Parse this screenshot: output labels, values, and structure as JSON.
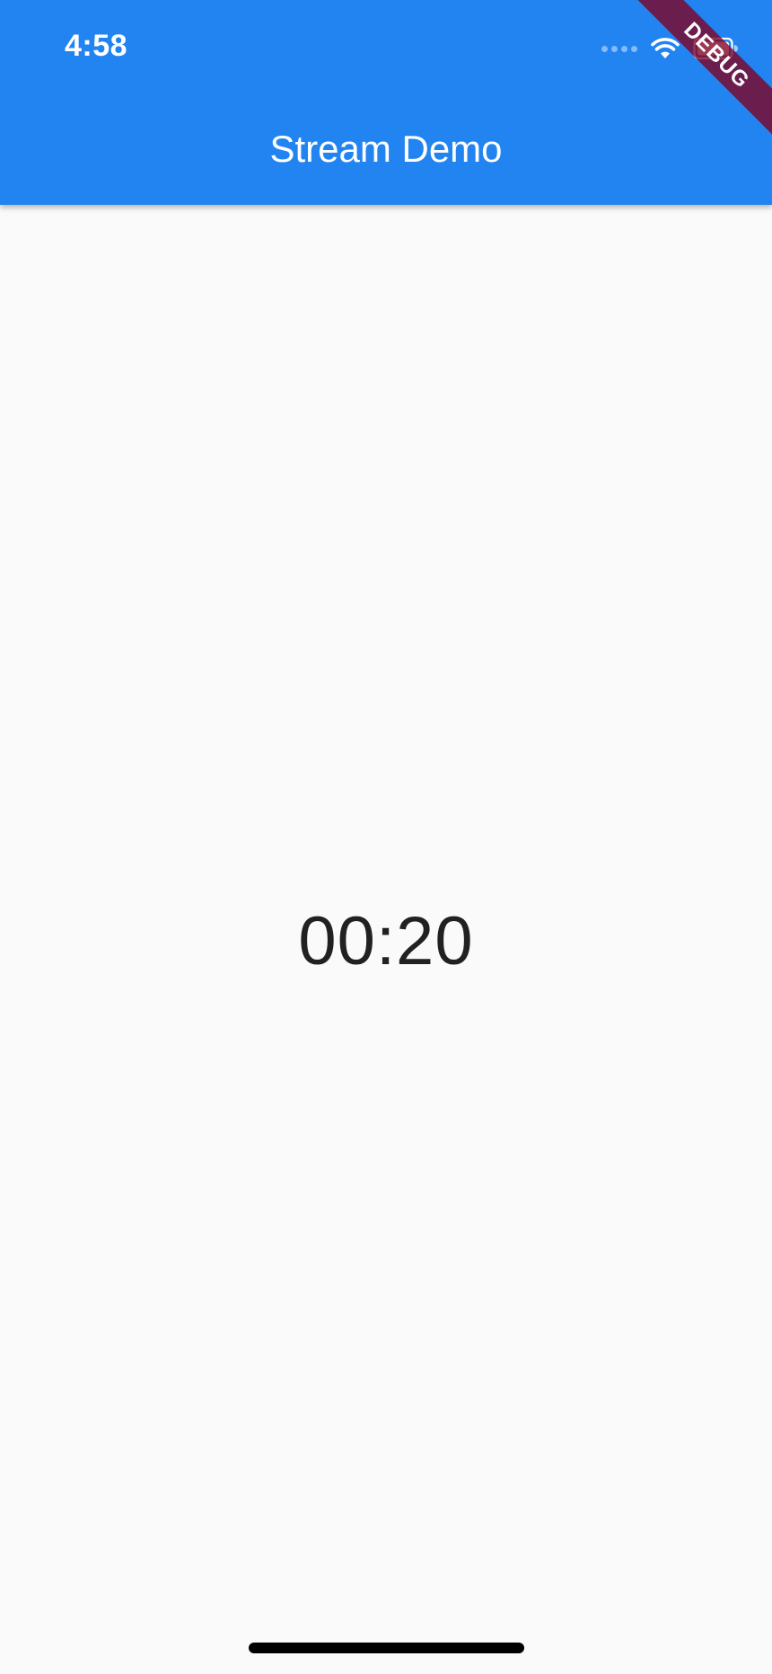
{
  "status_bar": {
    "time": "4:58",
    "icons": [
      "signal-icon",
      "wifi-icon",
      "battery-icon"
    ]
  },
  "app_bar": {
    "title": "Stream Demo",
    "color": "#2184f0"
  },
  "main": {
    "timer_text": "00:20"
  },
  "debug_banner": {
    "label": "DEBUG",
    "color": "#800020"
  },
  "colors": {
    "background": "#fafafa",
    "text": "#212121"
  }
}
